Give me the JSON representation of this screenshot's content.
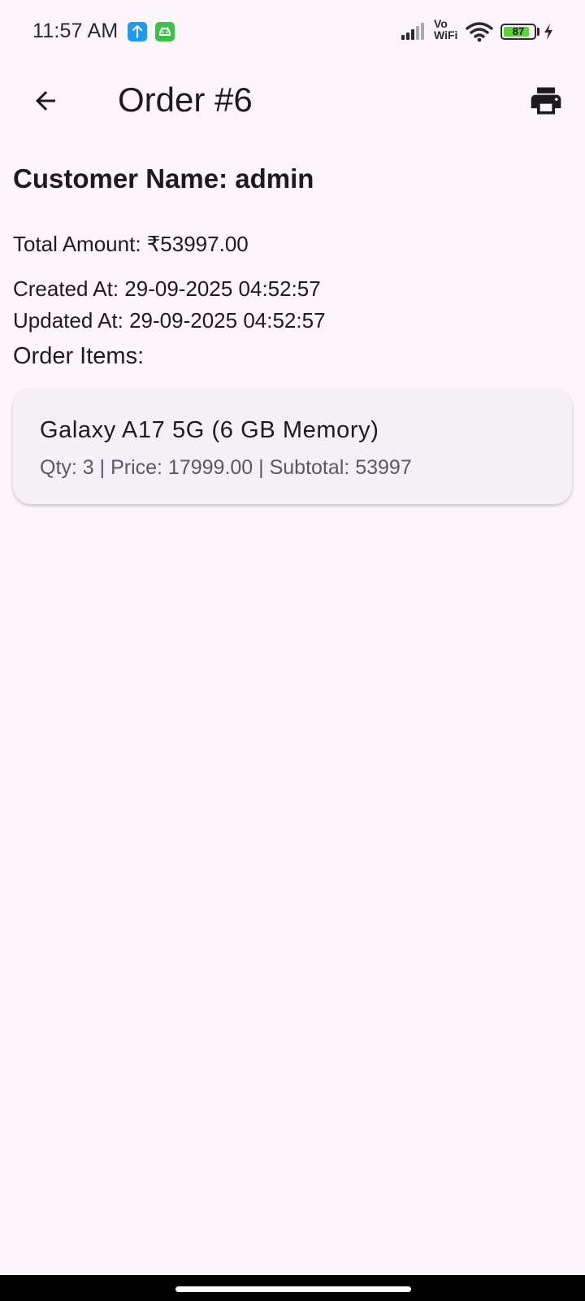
{
  "status_bar": {
    "time": "11:57 AM",
    "network_label_top": "Vo",
    "network_label_bottom": "WiFi",
    "battery_level": "87",
    "battery_fraction": 0.87,
    "icons": [
      "upload-notification-icon",
      "android-notification-icon",
      "signal-icon",
      "wifi-icon",
      "battery-icon",
      "charging-icon"
    ]
  },
  "app_bar": {
    "title": "Order #6",
    "back_icon": "arrow-back-icon",
    "print_icon": "print-icon"
  },
  "order": {
    "customer_line": "Customer Name: admin",
    "total_line": "Total Amount: ₹53997.00",
    "created_line": "Created At: 29-09-2025 04:52:57",
    "updated_line": "Updated At: 29-09-2025 04:52:57",
    "items_label": "Order Items:",
    "items": [
      {
        "name": "Galaxy A17 5G (6 GB Memory)",
        "details": "Qty: 3 | Price: 17999.00 | Subtotal: 53997"
      }
    ]
  },
  "colors": {
    "background": "#fcf6fc",
    "card": "#f5eff6",
    "text_primary": "#1d1b20",
    "text_secondary": "#5c5863",
    "battery_fill": "#5fd03a"
  }
}
